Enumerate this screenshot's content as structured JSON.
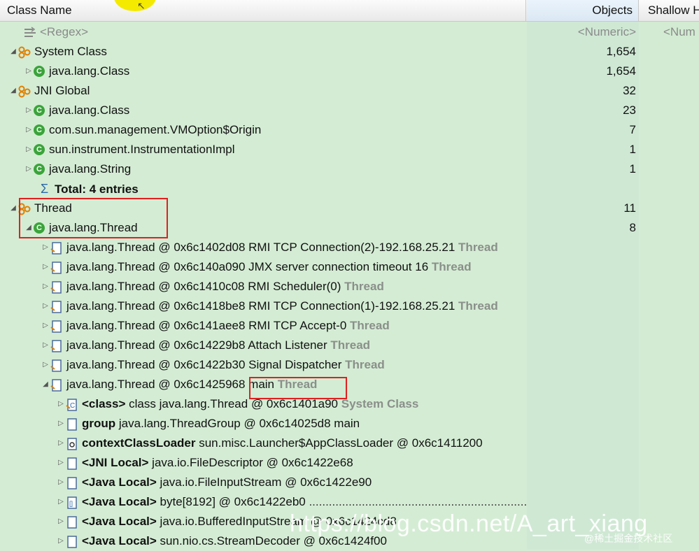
{
  "header": {
    "col1": "Class Name",
    "col2": "Objects",
    "col3": "Shallow H"
  },
  "rows": [
    {
      "text": "<Regex>",
      "objects": "<Numeric>",
      "shallow": "<Num"
    },
    {
      "text": "System Class",
      "objects": "1,654"
    },
    {
      "text": "java.lang.Class",
      "objects": "1,654"
    },
    {
      "text": "JNI Global",
      "objects": "32"
    },
    {
      "text": "java.lang.Class",
      "objects": "23"
    },
    {
      "text": "com.sun.management.VMOption$Origin",
      "objects": "7"
    },
    {
      "text": "sun.instrument.InstrumentationImpl",
      "objects": "1"
    },
    {
      "text": "java.lang.String",
      "objects": "1"
    },
    {
      "text": "Total: 4 entries",
      "objects": ""
    },
    {
      "text": "Thread",
      "objects": "11"
    },
    {
      "text": "java.lang.Thread",
      "objects": "8"
    },
    {
      "text": "java.lang.Thread @ 0x6c1402d08  RMI TCP Connection(2)-192.168.25.21",
      "suffix": "Thread"
    },
    {
      "text": "java.lang.Thread @ 0x6c140a090  JMX server connection timeout 16",
      "suffix": "Thread"
    },
    {
      "text": "java.lang.Thread @ 0x6c1410c08  RMI Scheduler(0)",
      "suffix": "Thread"
    },
    {
      "text": "java.lang.Thread @ 0x6c1418be8  RMI TCP Connection(1)-192.168.25.21",
      "suffix": "Thread"
    },
    {
      "text": "java.lang.Thread @ 0x6c141aee8  RMI TCP Accept-0",
      "suffix": "Thread"
    },
    {
      "text": "java.lang.Thread @ 0x6c14229b8  Attach Listener",
      "suffix": "Thread"
    },
    {
      "text": "java.lang.Thread @ 0x6c1422b30  Signal Dispatcher",
      "suffix": "Thread"
    },
    {
      "text": "java.lang.Thread @ 0x6c1425968  main",
      "suffix": "Thread"
    },
    {
      "bold": "<class>",
      "text": " class java.lang.Thread @ 0x6c1401a90",
      "suffix": "System Class"
    },
    {
      "bold": "group",
      "text": " java.lang.ThreadGroup @ 0x6c14025d8  main"
    },
    {
      "bold": "contextClassLoader",
      "text": " sun.misc.Launcher$AppClassLoader @ 0x6c1411200"
    },
    {
      "bold": "<JNI Local>",
      "text": " java.io.FileDescriptor @ 0x6c1422e68"
    },
    {
      "bold": "<Java Local>",
      "text": " java.io.FileInputStream @ 0x6c1422e90"
    },
    {
      "bold": "<Java Local>",
      "text": " byte[8192] @ 0x6c1422eb0",
      "tail": "  .................................................................."
    },
    {
      "bold": "<Java Local>",
      "text": " java.io.BufferedInputStream @ 0x6c1424cd8"
    },
    {
      "bold": "<Java Local>",
      "text": " sun.nio.cs.StreamDecoder @ 0x6c1424f00"
    }
  ],
  "watermark": "https://blog.csdn.net/A_art_xiang",
  "watermark2": "@稀土掘金技术社区",
  "colors": {
    "background": "#d4ecd4",
    "highlight_box": "#e02020",
    "class_icon": "#3aa43a"
  }
}
